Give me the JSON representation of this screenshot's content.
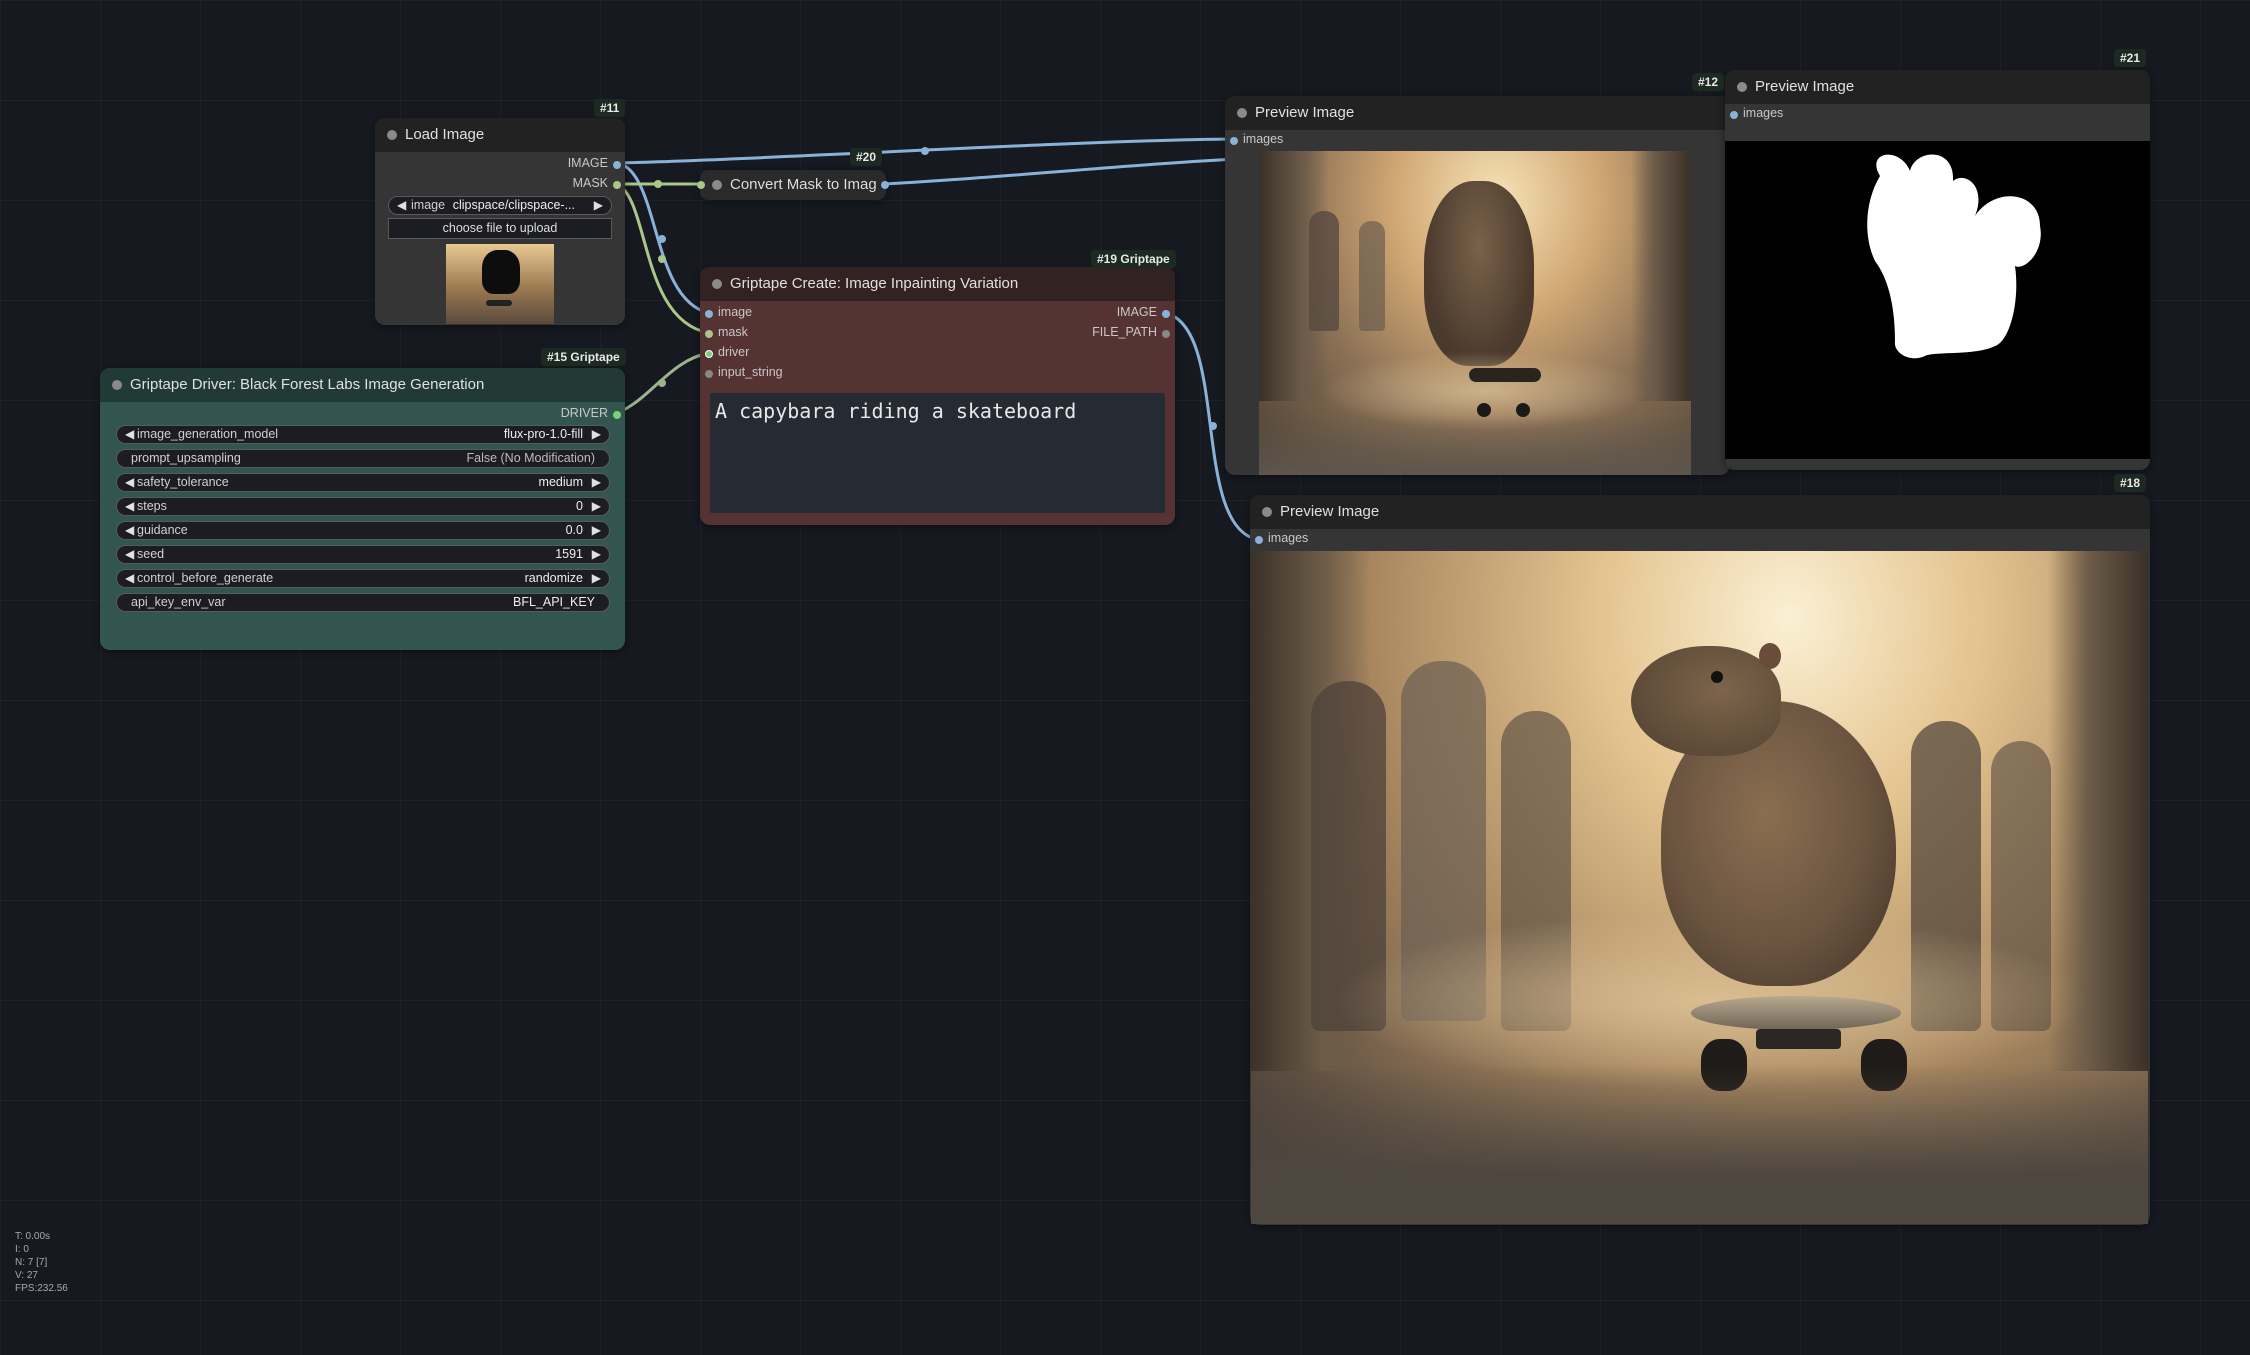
{
  "nodes": {
    "load_image": {
      "badge": "#11",
      "title": "Load Image",
      "outputs": [
        "IMAGE",
        "MASK"
      ],
      "image_widget_name": "image",
      "image_widget_value": "clipspace/clipspace-...",
      "upload_button": "choose file to upload"
    },
    "convert_mask": {
      "badge": "#20",
      "title": "Convert Mask to Imag"
    },
    "inpainting": {
      "badge": "#19 Griptape",
      "title": "Griptape Create: Image Inpainting Variation",
      "inputs": [
        "image",
        "mask",
        "driver",
        "input_string"
      ],
      "outputs": [
        "IMAGE",
        "FILE_PATH"
      ],
      "prompt": "A capybara riding a skateboard"
    },
    "driver": {
      "badge": "#15 Griptape",
      "title": "Griptape Driver: Black Forest Labs Image Generation",
      "output": "DRIVER",
      "widgets": [
        {
          "name": "image_generation_model",
          "value": "flux-pro-1.0-fill"
        },
        {
          "name": "prompt_upsampling",
          "value": "False (No Modification)"
        },
        {
          "name": "safety_tolerance",
          "value": "medium"
        },
        {
          "name": "steps",
          "value": "0"
        },
        {
          "name": "guidance",
          "value": "0.0"
        },
        {
          "name": "seed",
          "value": "1591"
        },
        {
          "name": "control_before_generate",
          "value": "randomize"
        },
        {
          "name": "api_key_env_var",
          "value": "BFL_API_KEY"
        }
      ]
    },
    "preview12": {
      "badge": "#12",
      "title": "Preview Image",
      "input": "images"
    },
    "preview21": {
      "badge": "#21",
      "title": "Preview Image",
      "input": "images"
    },
    "preview18": {
      "badge": "#18",
      "title": "Preview Image",
      "input": "images"
    }
  },
  "stats": {
    "t": "T: 0.00s",
    "i": "I: 0",
    "n": "N: 7 [7]",
    "v": "V: 27",
    "fps": "FPS:232.56"
  },
  "colors": {
    "canvas_bg": "#161a20",
    "node_bg": "#353535",
    "node_title": "#222",
    "driver_bg": "#335550",
    "driver_title": "#223a35",
    "inpaint_bg": "#553333",
    "inpaint_title": "#332222",
    "image_wire": "#8ab2d8",
    "mask_wire": "#a9c789",
    "driver_wire": "#9bb38e",
    "driver_slot": "#7ad07a"
  }
}
